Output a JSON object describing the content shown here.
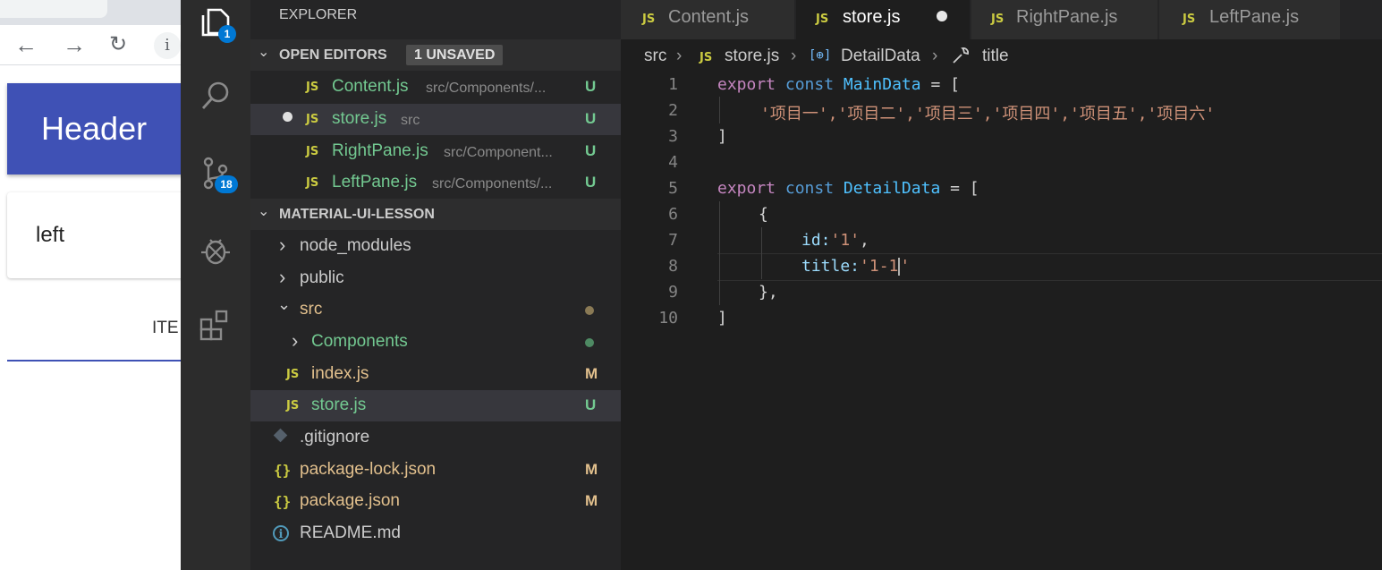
{
  "browser": {
    "nav": {
      "back_icon": "arrow-left-icon",
      "forward_icon": "arrow-right-icon",
      "reload_icon": "reload-icon",
      "info_glyph": "i"
    },
    "app_header_text": "Header",
    "paper_text": "left",
    "tab_label_partial": "ITE",
    "colors": {
      "app_bar": "#3f51b5"
    }
  },
  "activity_bar": {
    "explorer_badge": "1",
    "scm_badge": "18",
    "icons": [
      "files-icon",
      "search-icon",
      "source-control-icon",
      "debug-icon",
      "extensions-icon"
    ]
  },
  "sidebar": {
    "title": "EXPLORER",
    "open_editors": {
      "title": "OPEN EDITORS",
      "badge": "1 UNSAVED",
      "items": [
        {
          "name": "Content.js",
          "path": "src/Components/...",
          "status": "U"
        },
        {
          "name": "store.js",
          "path": "src",
          "status": "U"
        },
        {
          "name": "RightPane.js",
          "path": "src/Component...",
          "status": "U"
        },
        {
          "name": "LeftPane.js",
          "path": "src/Components/...",
          "status": "U"
        }
      ]
    },
    "project": {
      "title": "MATERIAL-UI-LESSON",
      "items": [
        {
          "name": "node_modules"
        },
        {
          "name": "public"
        },
        {
          "name": "src"
        },
        {
          "name": "Components"
        },
        {
          "name": "index.js",
          "status": "M"
        },
        {
          "name": "store.js",
          "status": "U"
        },
        {
          "name": ".gitignore"
        },
        {
          "name": "package-lock.json",
          "status": "M"
        },
        {
          "name": "package.json",
          "status": "M"
        },
        {
          "name": "README.md"
        }
      ]
    },
    "file_type_label": "JS",
    "json_glyph": "{}",
    "info_glyph": "i"
  },
  "editor": {
    "tabs": [
      {
        "label": "Content.js"
      },
      {
        "label": "store.js"
      },
      {
        "label": "RightPane.js"
      },
      {
        "label": "LeftPane.js"
      }
    ],
    "breadcrumb": [
      "src",
      "store.js",
      "DetailData",
      "title"
    ],
    "line_numbers": [
      "1",
      "2",
      "3",
      "4",
      "5",
      "6",
      "7",
      "8",
      "9",
      "10"
    ],
    "code": {
      "l1": {
        "kw": "export",
        "kw2": "const",
        "id": "MainData",
        "rest": " = ["
      },
      "l2": "'项目一','项目二','项目三','项目四','项目五','项目六'",
      "l3": "]",
      "l5": {
        "kw": "export",
        "kw2": "const",
        "id": "DetailData",
        "rest": " = ["
      },
      "l6": "{",
      "l7": {
        "prop": "id:",
        "val": "'1'",
        "tail": ","
      },
      "l8": {
        "prop": "title:",
        "val_a": "'1-1",
        "val_b": "'"
      },
      "l9": "},",
      "l10": "]"
    },
    "colors": {
      "keyword": "#c586c0",
      "storage": "#569cd6",
      "constant": "#4fc1ff",
      "string": "#ce9178",
      "property": "#9cdcfe"
    }
  }
}
